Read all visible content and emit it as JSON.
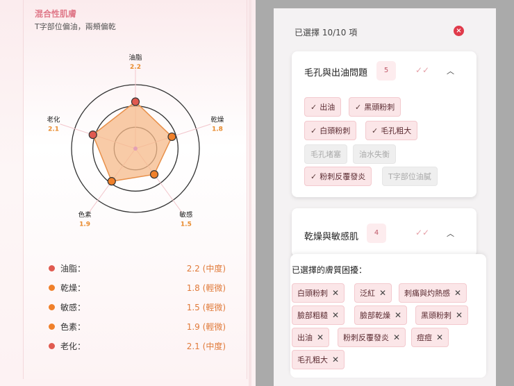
{
  "left": {
    "title": "混合性肌膚",
    "subtitle": "T字部位偏油，兩頰偏乾",
    "radar_axes": [
      {
        "name": "油脂",
        "value": "2.2"
      },
      {
        "name": "乾燥",
        "value": "1.8"
      },
      {
        "name": "敏感",
        "value": "1.5"
      },
      {
        "name": "色素",
        "value": "1.9"
      },
      {
        "name": "老化",
        "value": "2.1"
      }
    ],
    "radar_values": [
      2.2,
      1.8,
      1.5,
      1.9,
      2.1
    ],
    "radar_max": 3,
    "legend": [
      {
        "name": "油脂：",
        "value": "2.2 (中度)",
        "color": "#e05a50"
      },
      {
        "name": "乾燥：",
        "value": "1.8 (輕微)",
        "color": "#f0802a"
      },
      {
        "name": "敏感：",
        "value": "1.5 (輕微)",
        "color": "#f0802a"
      },
      {
        "name": "色素：",
        "value": "1.9 (輕微)",
        "color": "#f0802a"
      },
      {
        "name": "老化：",
        "value": "2.1 (中度)",
        "color": "#e05a50"
      }
    ]
  },
  "right": {
    "selected_count": "已選擇 10/10 項",
    "close_icon": "×",
    "group1": {
      "title": "毛孔與出油問題",
      "count": "5",
      "chips": [
        {
          "label": "出油",
          "checked": true
        },
        {
          "label": "黑頭粉刺",
          "checked": true
        },
        {
          "label": "白頭粉刺",
          "checked": true
        },
        {
          "label": "毛孔粗大",
          "checked": true
        },
        {
          "label": "毛孔堵塞",
          "checked": false
        },
        {
          "label": "油水失衡",
          "checked": false
        },
        {
          "label": "粉刺反覆發炎",
          "checked": true
        },
        {
          "label": "T字部位油膩",
          "checked": false
        }
      ]
    },
    "group2": {
      "title": "乾燥與敏感肌",
      "count": "4"
    },
    "selected_panel": {
      "title": "已選擇的膚質困擾：",
      "tags": [
        "白頭粉刺",
        "泛紅",
        "刺痛與灼熱感",
        "臉部粗糙",
        "臉部乾燥",
        "黑頭粉刺",
        "出油",
        "粉刺反覆發炎",
        "痘痘",
        "毛孔粗大"
      ]
    },
    "check_mark": "✓",
    "double_check": "✓✓",
    "chevron_up": "︿",
    "remove_mark": "✕"
  },
  "colors": {
    "accent": "#e07a8a",
    "radar_fill": "#f5b98a",
    "radar_point": "#e05a30"
  }
}
